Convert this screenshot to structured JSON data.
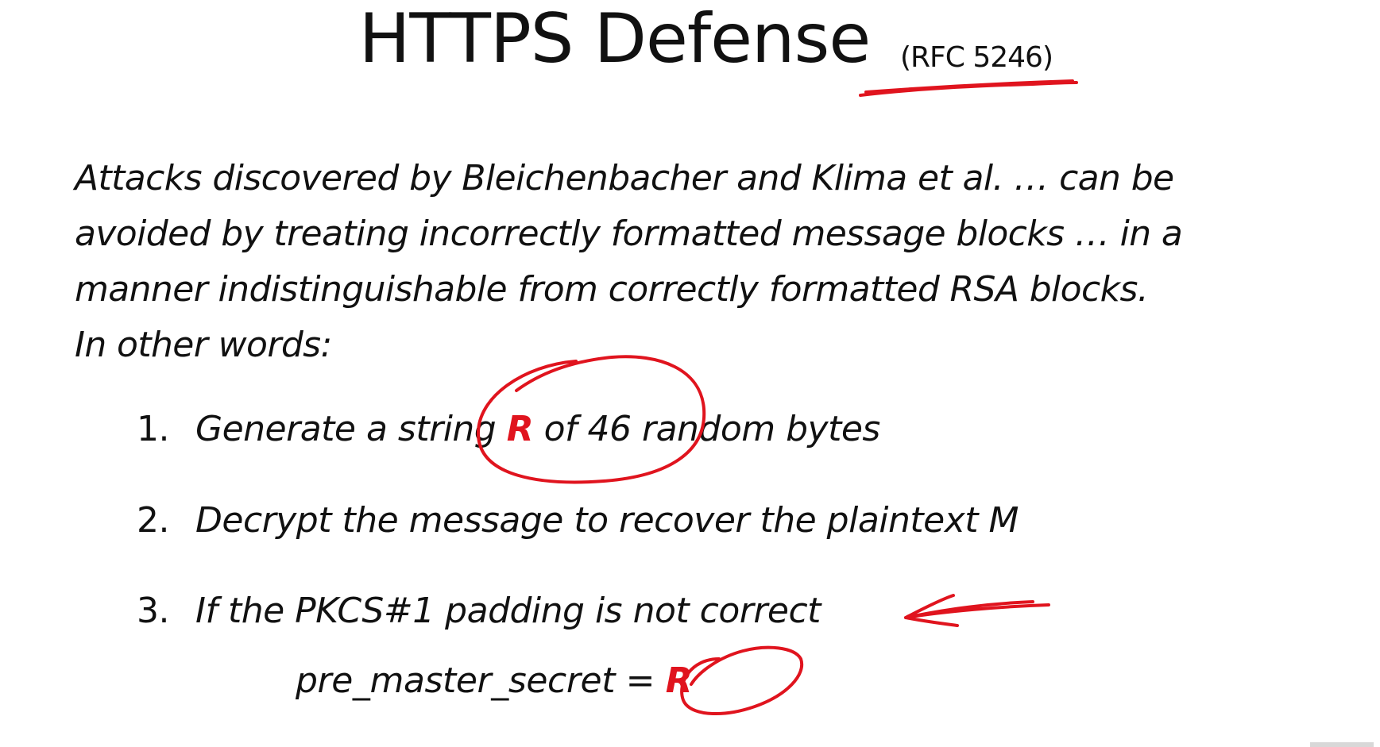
{
  "slide": {
    "title": "HTTPS Defense",
    "rfc": "(RFC 5246)",
    "intro_lines": [
      "Attacks discovered by Bleichenbacher and Klima et al. … can be",
      "avoided by treating incorrectly formatted message blocks … in a",
      "manner indistinguishable from correctly formatted RSA blocks.",
      "In other words:"
    ],
    "steps": [
      {
        "num": "1.",
        "before": "Generate a string ",
        "highlight": "R",
        "after": " of 46 random bytes"
      },
      {
        "num": "2.",
        "text": "Decrypt the message to recover the plaintext M"
      },
      {
        "num": "3.",
        "text": "If the PKCS#1 padding is not correct"
      }
    ],
    "assignment": {
      "lhs": "pre_master_secret = ",
      "rhs": "R"
    }
  },
  "colors": {
    "text": "#111111",
    "accent_red": "#e0141e",
    "annotation_ink": "#e0141e"
  }
}
